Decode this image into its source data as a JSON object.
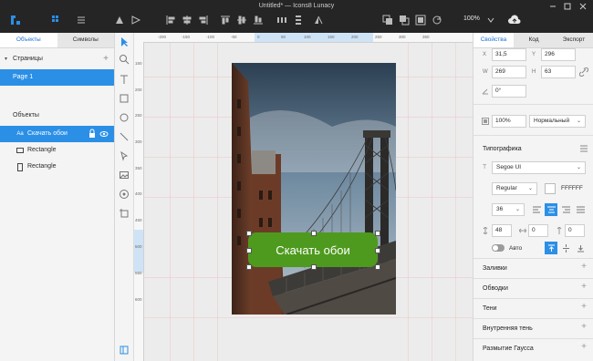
{
  "window": {
    "title": "Untitled* — Icons8 Lunacy"
  },
  "toolbar": {
    "zoom_label": "100%"
  },
  "left_panel": {
    "tabs": [
      {
        "label": "Объекты"
      },
      {
        "label": "Символы"
      }
    ],
    "pages_heading": "Страницы",
    "pages": [
      {
        "label": "Page 1"
      }
    ],
    "layers_heading": "Объекты",
    "layers": [
      {
        "label": "Скачать обои",
        "icon": "text-icon"
      },
      {
        "label": "Rectangle",
        "icon": "rectangle-icon"
      },
      {
        "label": "Rectangle",
        "icon": "rectangle-icon"
      }
    ]
  },
  "canvas": {
    "ruler_top": [
      "-200",
      "-150",
      "-100",
      "-50",
      "0",
      "50",
      "100",
      "150",
      "200",
      "250",
      "300",
      "350"
    ],
    "ruler_left": [
      "150",
      "200",
      "250",
      "300",
      "350",
      "400",
      "450",
      "500",
      "550",
      "600"
    ],
    "button_text": "Скачать обои",
    "button_color": "#4e9a1e"
  },
  "right_panel": {
    "tabs": [
      {
        "label": "Свойства"
      },
      {
        "label": "Код"
      },
      {
        "label": "Экспорт"
      }
    ],
    "x_label": "X",
    "x_value": "31,5",
    "y_label": "Y",
    "y_value": "296",
    "w_label": "W",
    "w_value": "269",
    "h_label": "H",
    "h_value": "63",
    "rotation_value": "0°",
    "opacity_value": "100%",
    "blend_mode": "Нормальный",
    "typography_heading": "Типографика",
    "font_family": "Segoe UI",
    "font_weight": "Regular",
    "font_color": "FFFFFF",
    "font_size": "36",
    "line_height": "48",
    "letter_spacing": "0",
    "paragraph_spacing": "0",
    "auto_label": "Авто",
    "sections": [
      {
        "label": "Заливки"
      },
      {
        "label": "Обводки"
      },
      {
        "label": "Тени"
      },
      {
        "label": "Внутренняя тень"
      },
      {
        "label": "Размытие Гаусса"
      }
    ]
  }
}
